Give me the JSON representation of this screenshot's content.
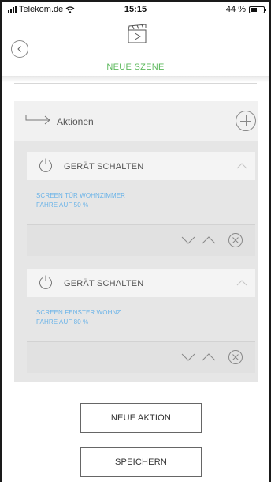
{
  "status_bar": {
    "carrier": "Telekom.de",
    "time": "15:15",
    "battery": "44 %"
  },
  "header": {
    "title": "NEUE SZENE",
    "back_icon": "chevron-left-icon",
    "scene_icon": "clapperboard-play-icon"
  },
  "actions": {
    "label": "Aktionen",
    "items": [
      {
        "title": "GERÄT SCHALTEN",
        "lines": [
          "SCREEN TÜR WOHNZIMMER",
          "FAHRE AUF 50 %"
        ]
      },
      {
        "title": "GERÄT SCHALTEN",
        "lines": [
          "SCREEN FENSTER WOHNZ.",
          "FAHRE AUF 80 %"
        ]
      }
    ]
  },
  "buttons": {
    "new_action": "NEUE AKTION",
    "save": "SPEICHERN"
  },
  "colors": {
    "accent_green": "#5cb85c",
    "link_blue": "#6ab3e8",
    "card_bg": "#f1f1f1",
    "body_bg": "#e6e6e6"
  }
}
